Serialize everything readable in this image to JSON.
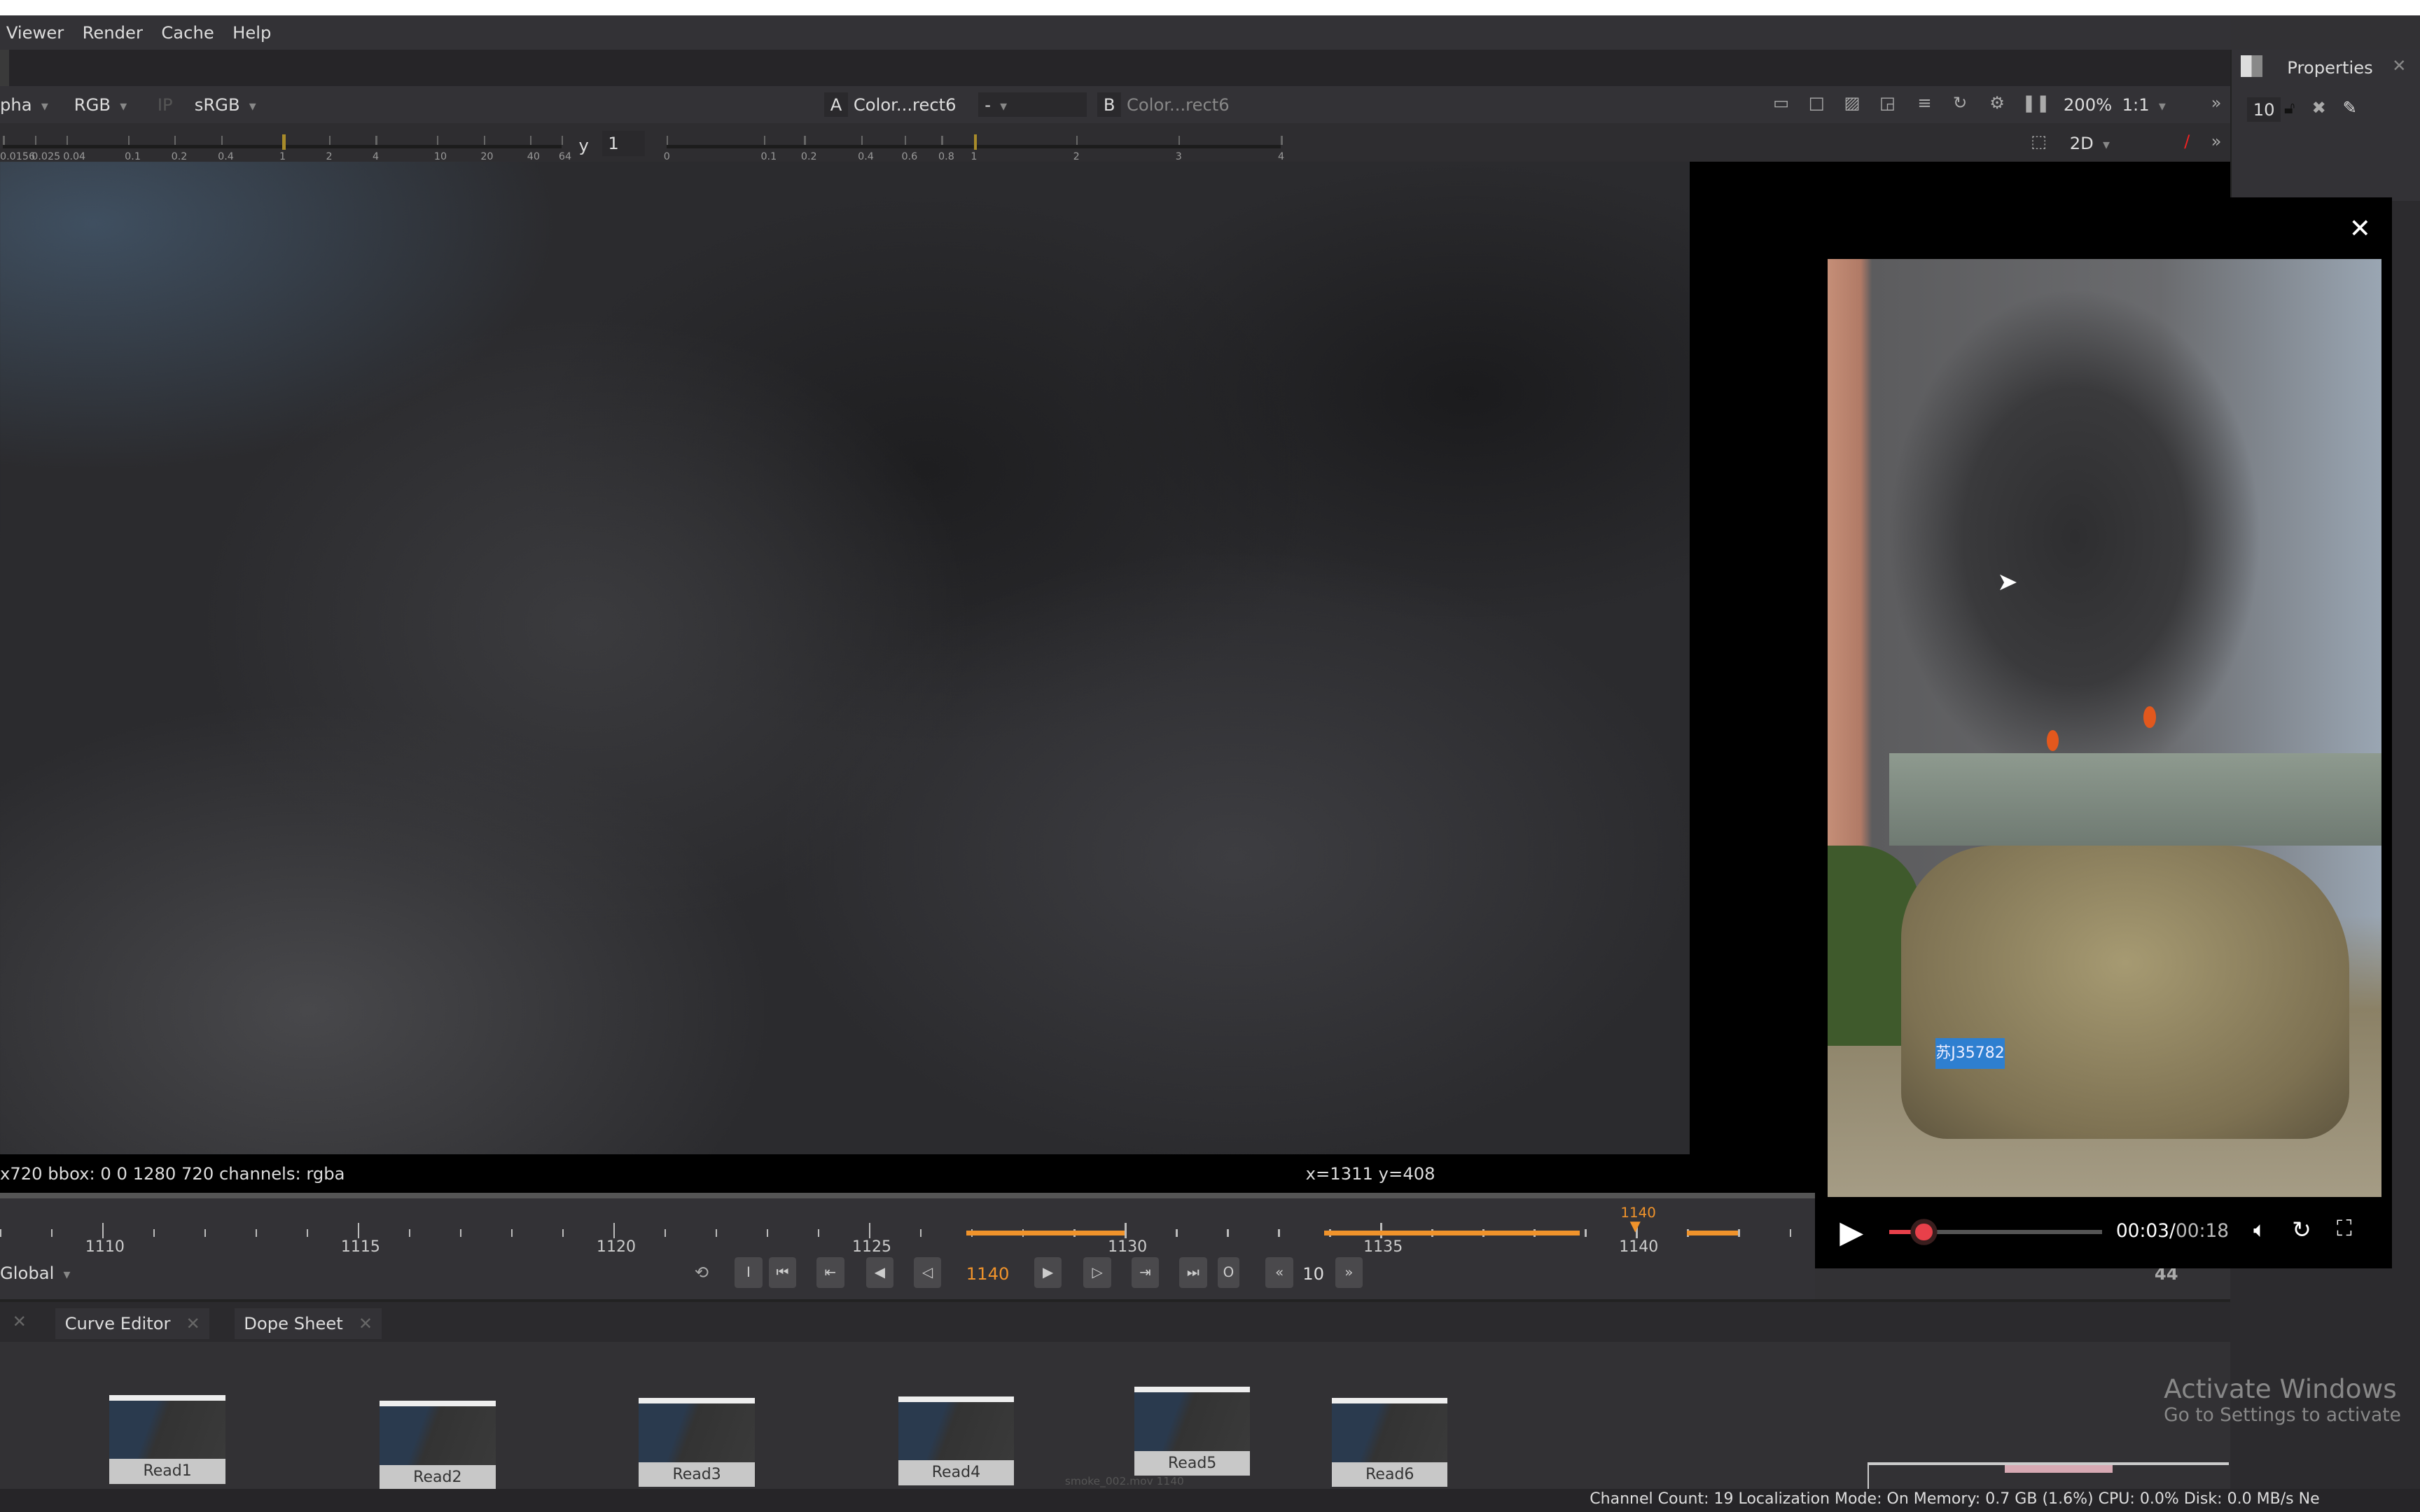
{
  "menu": [
    "Viewer",
    "Render",
    "Cache",
    "Help"
  ],
  "viewer_toolbar": {
    "channels_alpha": "pha",
    "channels": "RGB",
    "ip": "IP",
    "colorspace": "sRGB",
    "input_a_label": "A",
    "input_a": "Color...rect6",
    "compare_mode": "-",
    "input_b_label": "B",
    "input_b": "Color...rect6",
    "zoom": "200%",
    "ratio": "1:1",
    "view_mode": "2D",
    "icons": [
      "safe-area-icon",
      "frame-icon",
      "stripes-icon",
      "wipe-icon",
      "lines-icon",
      "refresh-icon",
      "gear-icon",
      "pause-icon"
    ]
  },
  "gain_scale": {
    "labels": [
      "0.0156",
      "0.025",
      "0.04",
      "0.1",
      "0.2",
      "0.4",
      "1",
      "2",
      "4",
      "10",
      "20",
      "40",
      "64"
    ],
    "value": 1
  },
  "gamma_scale": {
    "label": "y",
    "value": "1",
    "labels": [
      "0",
      "0.1",
      "0.2",
      "0.4",
      "0.6",
      "0.8",
      "1",
      "2",
      "3",
      "4"
    ]
  },
  "properties": {
    "title": "Properties",
    "max_panels": "10",
    "icons": [
      "lock-open-icon",
      "clear-icon",
      "pencil-icon"
    ]
  },
  "info_bar": {
    "format": "x720  bbox: 0 0 1280 720 channels: rgba",
    "coords": "x=1311 y=408"
  },
  "timeline": {
    "ticks": [
      "1110",
      "1115",
      "1120",
      "1125",
      "1130",
      "1135",
      "1140"
    ],
    "current_frame": "1140",
    "marker_label": "1140",
    "scope": "Global",
    "increment": "10",
    "fps": "44",
    "cached_ranges": [
      [
        1126.9,
        1130
      ],
      [
        1133.9,
        1138.9
      ],
      [
        1141,
        1142
      ]
    ],
    "frame_min": 1108,
    "frame_max": 1143.5,
    "accent": "#f0932b"
  },
  "bottom_tabs": [
    "Curve Editor",
    "Dope Sheet"
  ],
  "nodes": [
    "Read1",
    "Read2",
    "Read3",
    "Read4",
    "Read5",
    "Read6"
  ],
  "node_caption": "smoke_002.mov 1140",
  "watermark": {
    "line1": "Activate Windows",
    "line2": "Go to Settings to activate"
  },
  "status": "Channel Count: 19  Localization Mode: On  Memory: 0.7 GB (1.6%)  CPU: 0.0%  Disk: 0.0 MB/s  Ne",
  "video_popup": {
    "close": "✕",
    "plate": "苏J35782",
    "time_current": "00:03",
    "time_sep": "/",
    "time_total": "00:18",
    "progress": 0.167,
    "accent": "#e8404a"
  }
}
